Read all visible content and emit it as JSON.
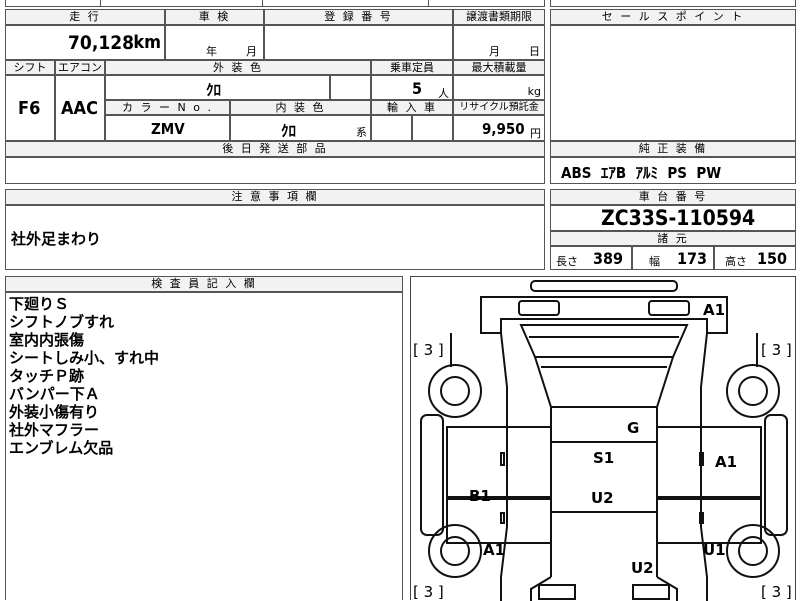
{
  "vehicle": {
    "mileage_header": "走 行",
    "mileage_value": "70,128",
    "mileage_unit": "km",
    "inspection_header": "車 検",
    "inspection_year_label": "年",
    "inspection_month_label": "月",
    "registration_header": "登 録 番 号",
    "transfer_header": "譲渡書類期限",
    "transfer_month_label": "月",
    "transfer_day_label": "日",
    "shift_header": "シフト",
    "ac_header": "エアコン",
    "exterior_color_header": "外 装 色",
    "capacity_header": "乗車定員",
    "max_load_header": "最大積載量",
    "shift_value": "F6",
    "ac_value": "AAC",
    "exterior_color_value": "ｸﾛ",
    "capacity_value": "5",
    "capacity_unit": "人",
    "max_load_unit": "kg",
    "color_no_header": "カ ラ ー  N o .",
    "interior_color_header": "内 装 色",
    "import_header": "輸 入 車",
    "recycle_header": "リサイクル預託金",
    "color_no_value": "ZMV",
    "interior_color_value": "ｸﾛ",
    "interior_color_suffix": "系",
    "recycle_value": "9,950",
    "recycle_unit": "円",
    "later_parts_header": "後 日 発 送 部 品"
  },
  "sales_point": {
    "header": "セ ー ル ス ポ イ ン ト"
  },
  "standard_equipment": {
    "header": "純 正 装 備",
    "value": "ABS  ｴｱB  ｱﾙﾐ  PS  PW"
  },
  "notes": {
    "header": "注 意 事 項 欄",
    "value": "社外足まわり"
  },
  "chassis": {
    "header": "車 台 番 号",
    "value": "ZC33S-110594",
    "dimensions_header": "諸 元",
    "length_label": "長さ",
    "length_value": "389",
    "width_label": "幅",
    "width_value": "173",
    "height_label": "高さ",
    "height_value": "150"
  },
  "inspector": {
    "header": "検 査 員 記 入 欄",
    "lines": [
      "下廻りＳ",
      "シフトノブすれ",
      "室内内張傷",
      "シートしみ小、すれ中",
      "タッチＰ跡",
      "バンパー下Ａ",
      "外装小傷有り",
      "社外マフラー",
      "エンブレム欠品"
    ]
  },
  "diagram": {
    "tire_tl": "[ 3 ]",
    "tire_tr": "[ 3 ]",
    "tire_bl": "[ 3 ]",
    "tire_br": "[ 3 ]",
    "marks": [
      "A1",
      "G",
      "S1",
      "A1",
      "B1",
      "U2",
      "A1",
      "U1",
      "U2"
    ]
  }
}
